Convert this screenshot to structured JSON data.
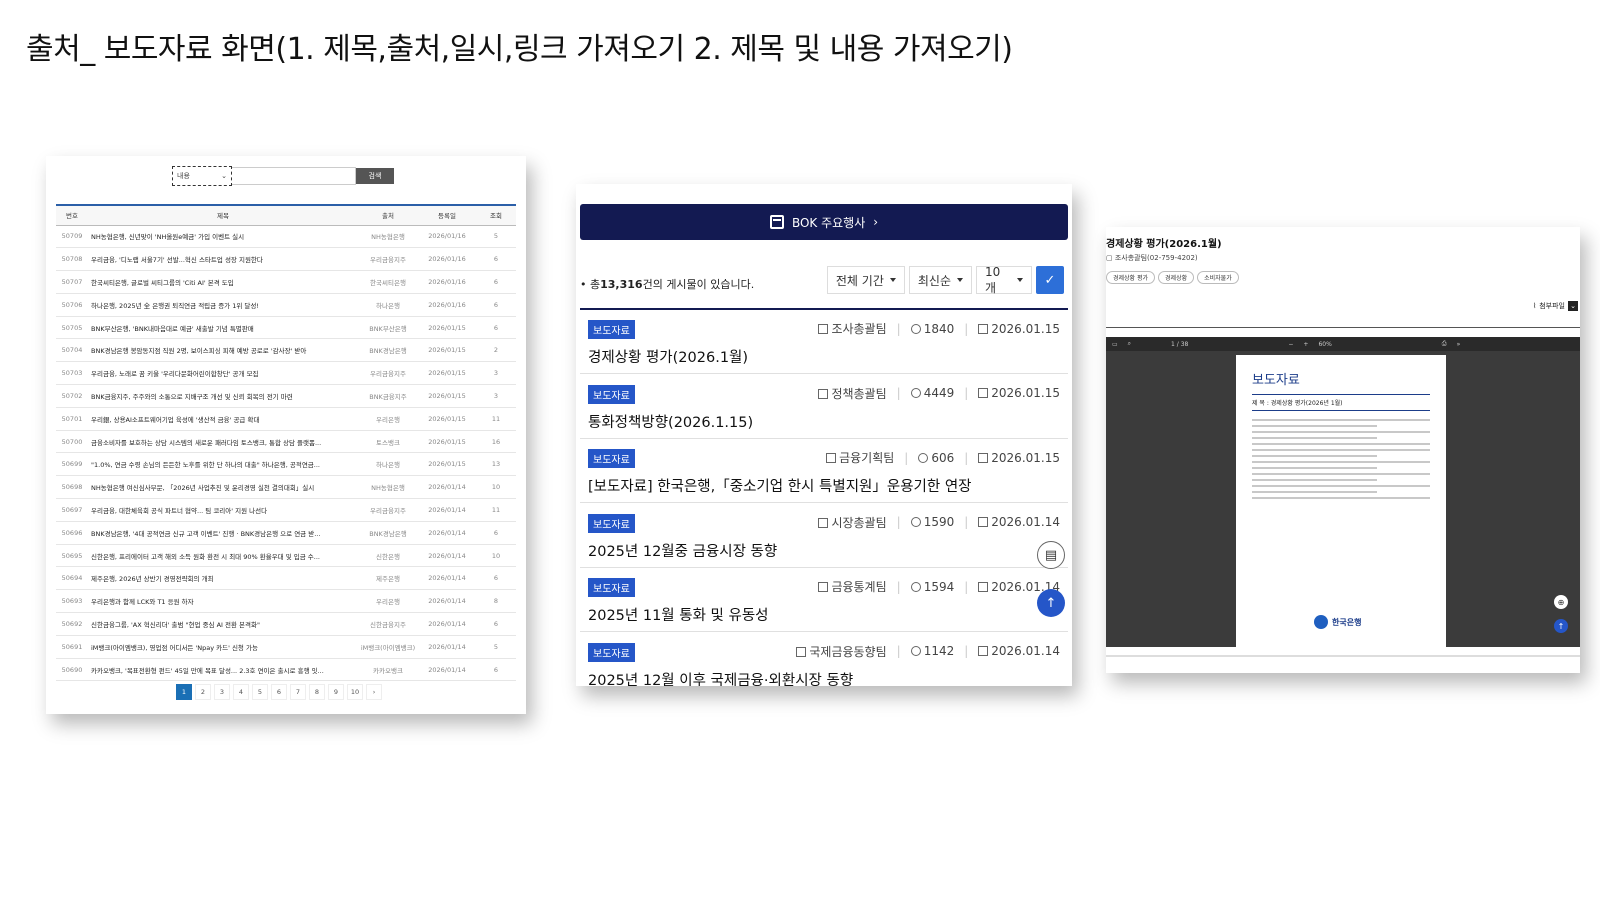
{
  "slide": {
    "title": "출처_ 보도자료 화면(1. 제목,출처,일시,링크 가져오기 2. 제목 및 내용 가져오기)"
  },
  "panel_list": {
    "search": {
      "select_value": "내용",
      "button_label": "검색"
    },
    "columns": [
      "번호",
      "제목",
      "출처",
      "등록일",
      "조회"
    ],
    "rows": [
      [
        "50709",
        "NH농협은행, 신년맞이 'NH올원e예금' 가입 이벤트 실시",
        "NH농협은행",
        "2026/01/16",
        "5"
      ],
      [
        "50708",
        "우리금융, '디노랩 서울7기' 선발...혁신 스타트업 성장 지원한다",
        "우리금융지주",
        "2026/01/16",
        "6"
      ],
      [
        "50707",
        "한국씨티은행, 글로벌 씨티그룹의 'Citi AI' 본격 도입",
        "한국씨티은행",
        "2026/01/16",
        "6"
      ],
      [
        "50706",
        "하나은행, 2025년 全 은행권 퇴직연금 적립금 증가 1위 달성!",
        "하나은행",
        "2026/01/16",
        "6"
      ],
      [
        "50705",
        "BNK부산은행, 'BNK내마음대로 예금' 새출발 기념 특별판매",
        "BNK부산은행",
        "2026/01/15",
        "6"
      ],
      [
        "50704",
        "BNK경남은행 봉암동지점 직원 2명, 보이스피싱 피해 예방 공로로 '감사장' 받아",
        "BNK경남은행",
        "2026/01/15",
        "2"
      ],
      [
        "50703",
        "우리금융, 노래로 꿈 키울 '우리다문화어린이합창단' 공개 모집",
        "우리금융지주",
        "2026/01/15",
        "3"
      ],
      [
        "50702",
        "BNK금융지주, 주주와의 소통으로 지배구조 개선 및 신뢰 회복의 전기 마련",
        "BNK금융지주",
        "2026/01/15",
        "3"
      ],
      [
        "50701",
        "우리銀, 상용AI소프트웨어기업 육성에 '생산적 금융' 공급 확대",
        "우리은행",
        "2026/01/15",
        "11"
      ],
      [
        "50700",
        "금융소비자를 보호하는 상담 시스템의 새로운 패러다임 토스뱅크, 통합 상담 플랫폼...",
        "토스뱅크",
        "2026/01/15",
        "16"
      ],
      [
        "50699",
        "\"1.0%, 연금 수령 손님의 든든한 노후를 위한 단 하나의 대출\" 하나은행, 공적연금...",
        "하나은행",
        "2026/01/15",
        "13"
      ],
      [
        "50698",
        "NH농협은행 여신심사부문, 「2026년 사업추진 및 윤리경영 실천 결의대회」실시",
        "NH농협은행",
        "2026/01/14",
        "10"
      ],
      [
        "50697",
        "우리금융, 대한체육회 공식 파트너 협약... 팀 코리아' 지원 나선다",
        "우리금융지주",
        "2026/01/14",
        "11"
      ],
      [
        "50696",
        "BNK경남은행, '4대 공적연금 신규 고객 이벤트' 진행 · BNK경남은행 으로 연금 받...",
        "BNK경남은행",
        "2026/01/14",
        "6"
      ],
      [
        "50695",
        "신한은행, 프리에이터 고객 해외 소득 원화 환전 시 최대 90% 환율우대 및 입금 수...",
        "신한은행",
        "2026/01/14",
        "10"
      ],
      [
        "50694",
        "제주은행, 2026년 상반기 경영전략회의 개최",
        "제주은행",
        "2026/01/14",
        "6"
      ],
      [
        "50693",
        "우리은행과 함께 LCK와 T1 응원 하자",
        "우리은행",
        "2026/01/14",
        "8"
      ],
      [
        "50692",
        "신한금융그룹, 'AX 혁신리더' 출범 \"현업 중심 AI 전환 본격화\"",
        "신한금융지주",
        "2026/01/14",
        "6"
      ],
      [
        "50691",
        "iM뱅크(아이엠뱅크), 영업점 어디서든 'Npay 카드' 신청 가능",
        "iM뱅크(아이엠뱅크)",
        "2026/01/14",
        "5"
      ],
      [
        "50690",
        "카카오뱅크, '목표전환형 펀드' 45일 만에 목표 달성... 2.3호 연이은 출시로 흥행 잇...",
        "카카오뱅크",
        "2026/01/14",
        "6"
      ]
    ],
    "pages": [
      "1",
      "2",
      "3",
      "4",
      "5",
      "6",
      "7",
      "8",
      "9",
      "10",
      "›"
    ],
    "current_page": "1"
  },
  "panel_bok": {
    "banner_label": "BOK 주요행사",
    "count_prefix": "총",
    "count_value": "13,316",
    "count_suffix": "건의 게시물이 있습니다.",
    "filters": {
      "period": "전체 기간",
      "sort": "최신순",
      "size": "10개"
    },
    "items": [
      {
        "tag": "보도자료",
        "dept": "조사총괄팀",
        "views": "1840",
        "date": "2026.01.15",
        "title": "경제상황 평가(2026.1월)"
      },
      {
        "tag": "보도자료",
        "dept": "정책총괄팀",
        "views": "4449",
        "date": "2026.01.15",
        "title": "통화정책방향(2026.1.15)"
      },
      {
        "tag": "보도자료",
        "dept": "금융기획팀",
        "views": "606",
        "date": "2026.01.15",
        "title": "[보도자료] 한국은행,「중소기업 한시 특별지원」운용기한 연장"
      },
      {
        "tag": "보도자료",
        "dept": "시장총괄팀",
        "views": "1590",
        "date": "2026.01.14",
        "title": "2025년 12월중 금융시장 동향"
      },
      {
        "tag": "보도자료",
        "dept": "금융통계팀",
        "views": "1594",
        "date": "2026.01.14",
        "title": "2025년 11월 통화 및 유동성"
      },
      {
        "tag": "보도자료",
        "dept": "국제금융동향팀",
        "views": "1142",
        "date": "2026.01.14",
        "title": "2025년 12월 이후 국제금융·외환시장 동향"
      }
    ]
  },
  "panel_detail": {
    "title": "경제상황 평가(2026.1월)",
    "dept": "조사총괄팀(02-759-4202)",
    "chips": [
      "경제상황 평가",
      "경제상황",
      "소비자물가"
    ],
    "attachment_label": "첨부파일",
    "viewer": {
      "page": "1",
      "total": "/ 38",
      "zoom": "60%"
    },
    "doc": {
      "heading": "보도자료",
      "subject": "제 목 : 경제상황 평가(2026년 1월)",
      "org": "한국은행"
    }
  }
}
